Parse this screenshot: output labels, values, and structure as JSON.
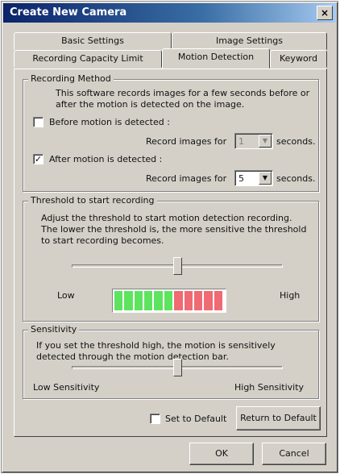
{
  "window": {
    "title": "Create New Camera",
    "close_glyph": "×"
  },
  "tabs": {
    "back_row": [
      "Basic Settings",
      "Image Settings"
    ],
    "front_row": [
      "Recording Capacity Limit",
      "Motion Detection",
      "Keyword"
    ],
    "active": "Motion Detection"
  },
  "recording_method": {
    "title": "Recording Method",
    "description": "This software records images for a few seconds before or after the motion is detected on the image.",
    "before": {
      "label": "Before motion is detected :",
      "checked": false,
      "check_glyph": "",
      "record_label": "Record images for",
      "value": "1",
      "unit": "seconds."
    },
    "after": {
      "label": "After motion is detected :",
      "checked": true,
      "check_glyph": "✓",
      "record_label": "Record images for",
      "value": "5",
      "unit": "seconds."
    }
  },
  "threshold": {
    "title": "Threshold to start recording",
    "description": "Adjust the threshold to start motion detection recording. The lower the threshold is, the more sensitive the threshold to start recording becomes.",
    "low_label": "Low",
    "high_label": "High",
    "level": 0.5,
    "meter": {
      "green_segments": 6,
      "red_segments": 5,
      "green": "#5ee35e",
      "red": "#ef6a72"
    }
  },
  "sensitivity": {
    "title": "Sensitivity",
    "description": "If you set the threshold high, the motion is sensitively detected through the motion detection bar.",
    "low_label": "Low Sensitivity",
    "high_label": "High Sensitivity",
    "level": 0.5
  },
  "defaults": {
    "set_label": "Set to Default",
    "set_checked": false,
    "return_label": "Return to Default"
  },
  "buttons": {
    "ok": "OK",
    "cancel": "Cancel"
  },
  "icons": {
    "dropdown": "▼",
    "close": "close-icon"
  }
}
